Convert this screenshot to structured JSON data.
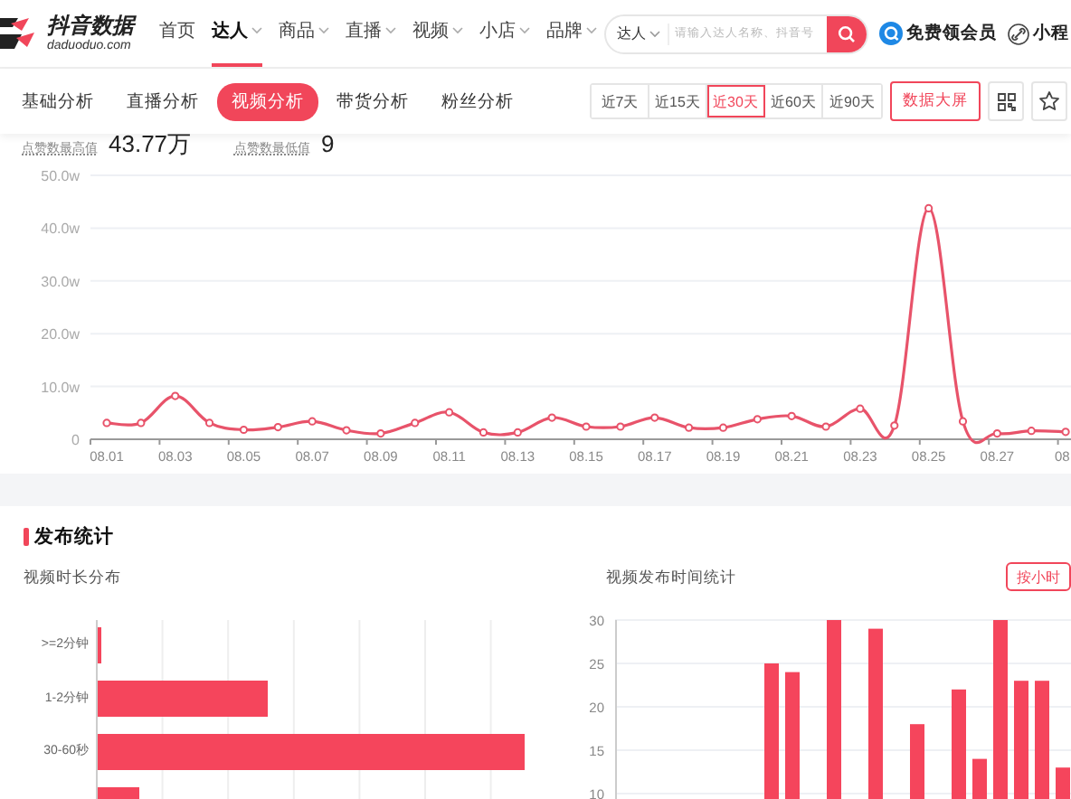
{
  "header": {
    "brand": {
      "name": "抖音数据",
      "domain": "daduoduo.com"
    },
    "nav": [
      {
        "label": "首页",
        "selected": false,
        "dropdown": false
      },
      {
        "label": "达人",
        "selected": true,
        "dropdown": true
      },
      {
        "label": "商品",
        "selected": false,
        "dropdown": true
      },
      {
        "label": "直播",
        "selected": false,
        "dropdown": true
      },
      {
        "label": "视频",
        "selected": false,
        "dropdown": true
      },
      {
        "label": "小店",
        "selected": false,
        "dropdown": true
      },
      {
        "label": "品牌",
        "selected": false,
        "dropdown": true
      }
    ],
    "search": {
      "scope": "达人",
      "placeholder": "请输入达人名称、抖音号"
    },
    "links": [
      {
        "kind": "member",
        "label": "免费领会员"
      },
      {
        "kind": "miniapp",
        "label": "小程"
      }
    ]
  },
  "subnav": {
    "tabs": [
      {
        "label": "基础分析",
        "selected": false
      },
      {
        "label": "直播分析",
        "selected": false
      },
      {
        "label": "视频分析",
        "selected": true
      },
      {
        "label": "带货分析",
        "selected": false
      },
      {
        "label": "粉丝分析",
        "selected": false
      }
    ],
    "ranges": [
      {
        "label": "近7天",
        "selected": false
      },
      {
        "label": "近15天",
        "selected": false
      },
      {
        "label": "近30天",
        "selected": true
      },
      {
        "label": "近60天",
        "selected": false
      },
      {
        "label": "近90天",
        "selected": false
      }
    ],
    "screen_button": "数据大屏"
  },
  "likes": {
    "stats": [
      {
        "label": "点赞数最高值",
        "value": "43.77万"
      },
      {
        "label": "点赞数最低值",
        "value": "9"
      }
    ],
    "chart_data": {
      "type": "line",
      "categories": [
        "08.01",
        null,
        "08.03",
        null,
        "08.05",
        null,
        "08.07",
        null,
        "08.09",
        null,
        "08.11",
        null,
        "08.13",
        null,
        "08.15",
        null,
        "08.17",
        null,
        "08.19",
        null,
        "08.21",
        null,
        "08.23",
        null,
        "08.25",
        null,
        "08.27",
        null,
        "08"
      ],
      "grid": true,
      "series": [
        {
          "color": "#e8536a",
          "marker": "circle",
          "values": [
            3.1,
            3.1,
            8.2,
            3.1,
            1.8,
            2.3,
            3.4,
            1.7,
            1.1,
            3.1,
            5.1,
            1.3,
            1.3,
            4.1,
            2.4,
            2.4,
            4.1,
            2.2,
            2.2,
            3.8,
            4.4,
            2.4,
            5.8,
            2.6,
            43.77,
            3.4,
            1.1,
            1.6,
            1.4
          ]
        }
      ],
      "ylim": [
        0,
        50
      ],
      "yticks": [
        {
          "value": 0,
          "label": "0"
        },
        {
          "value": 10,
          "label": "10.0w"
        },
        {
          "value": 20,
          "label": "20.0w"
        },
        {
          "value": 30,
          "label": "30.0w"
        },
        {
          "value": 40,
          "label": "40.0w"
        },
        {
          "value": 50,
          "label": "50.0w"
        }
      ]
    }
  },
  "publish": {
    "title": "发布统计",
    "duration": {
      "title": "视频时长分布",
      "categories": [
        ">=2分钟",
        "1-2分钟",
        "30-60秒"
      ]
    },
    "time": {
      "title": "视频发布时间统计",
      "toggle": "按小时",
      "chart_data": {
        "type": "bar",
        "grid": true,
        "ylim": [
          0,
          30
        ],
        "yticks": [
          10,
          15,
          20,
          25,
          30
        ],
        "values": [
          null,
          null,
          null,
          null,
          null,
          null,
          null,
          25,
          24,
          null,
          30,
          null,
          29,
          null,
          18,
          null,
          22,
          14,
          30,
          23,
          23,
          13
        ]
      }
    }
  }
}
